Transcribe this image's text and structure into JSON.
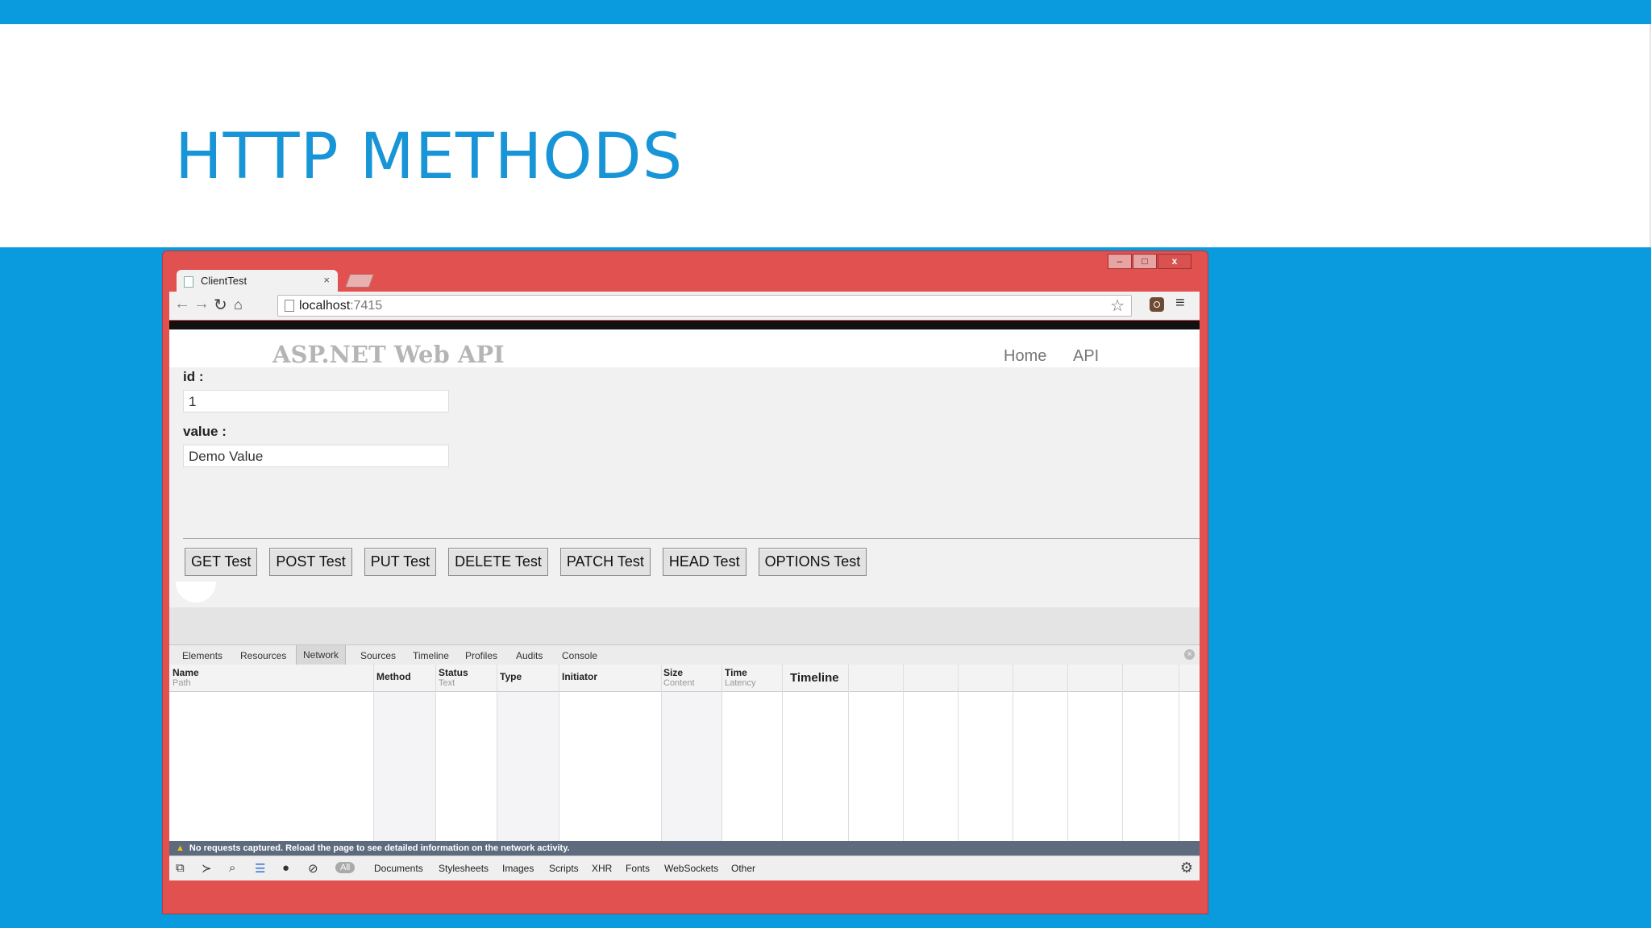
{
  "slide": {
    "title": "HTTP METHODS"
  },
  "window": {
    "minimize": "–",
    "maximize": "□",
    "close": "x"
  },
  "browser": {
    "tab_title": "ClientTest",
    "tab_close": "×",
    "url_host": "localhost",
    "url_port": ":7415",
    "icons": [
      "back-arrow",
      "forward-arrow",
      "reload",
      "home",
      "bookmark-star",
      "extension",
      "menu"
    ]
  },
  "site": {
    "title": "ASP.NET Web API",
    "nav": [
      "Home",
      "API"
    ]
  },
  "form": {
    "id_label": "id :",
    "id_value": "1",
    "value_label": "value :",
    "value_value": "Demo Value",
    "buttons": [
      "GET Test",
      "POST Test",
      "PUT Test",
      "DELETE Test",
      "PATCH Test",
      "HEAD Test",
      "OPTIONS Test"
    ]
  },
  "devtools": {
    "tabs": [
      "Elements",
      "Resources",
      "Network",
      "Sources",
      "Timeline",
      "Profiles",
      "Audits",
      "Console"
    ],
    "active_tab": "Network",
    "columns": [
      {
        "title": "Name",
        "sub": "Path"
      },
      {
        "title": "Method",
        "sub": ""
      },
      {
        "title": "Status",
        "sub": "Text"
      },
      {
        "title": "Type",
        "sub": ""
      },
      {
        "title": "Initiator",
        "sub": ""
      },
      {
        "title": "Size",
        "sub": "Content"
      },
      {
        "title": "Time",
        "sub": "Latency"
      },
      {
        "title": "Timeline",
        "sub": ""
      }
    ],
    "status_message": "No requests captured. Reload the page to see detailed information on the network activity.",
    "filter_all": "All",
    "filters": [
      "Documents",
      "Stylesheets",
      "Images",
      "Scripts",
      "XHR",
      "Fonts",
      "WebSockets",
      "Other"
    ]
  },
  "colors": {
    "slide_bg": "#0a9ade",
    "title": "#1895d6",
    "chrome_frame": "#e05150"
  }
}
